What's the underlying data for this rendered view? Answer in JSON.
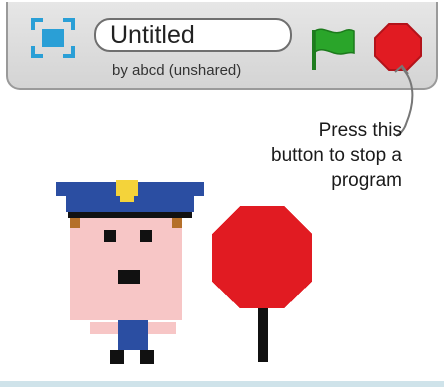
{
  "project": {
    "title": "Untitled",
    "author": "by abcd (unshared)"
  },
  "controls": {
    "fullscreen_icon": "fullscreen-icon",
    "green_flag_icon": "green-flag-icon",
    "stop_icon": "stop-sign-icon"
  },
  "annotation": {
    "lines": [
      "Press this",
      "button to stop a",
      "program"
    ]
  },
  "colors": {
    "flag": "#2aa52a",
    "stop": "#e11b22",
    "fullscreen": "#2a9fd6",
    "hat": "#2b4ea2",
    "badge": "#f4d33a",
    "skin": "#f7c6c6",
    "hair": "#b5702a"
  }
}
